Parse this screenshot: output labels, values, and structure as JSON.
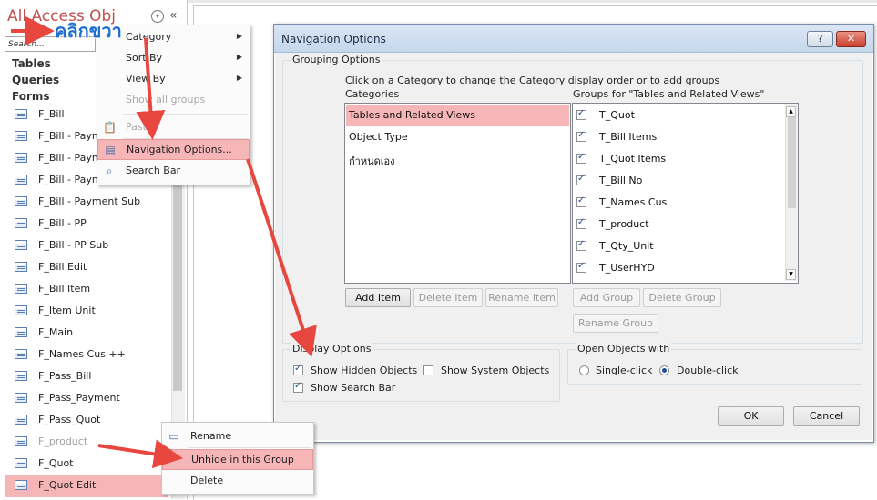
{
  "nav_pane": {
    "title": "All Access Obj",
    "collapse_glyph": "«",
    "dropdown_glyph": "▾",
    "search_placeholder": "Search...",
    "groups": [
      "Tables",
      "Queries",
      "Forms"
    ],
    "forms": [
      {
        "label": "F_Bill",
        "state": "normal"
      },
      {
        "label": "F_Bill - Paym",
        "state": "normal"
      },
      {
        "label": "F_Bill - Paym",
        "state": "normal"
      },
      {
        "label": "F_Bill - Paym",
        "state": "normal"
      },
      {
        "label": "F_Bill - Payment Sub",
        "state": "normal"
      },
      {
        "label": "F_Bill - PP",
        "state": "normal"
      },
      {
        "label": "F_Bill - PP Sub",
        "state": "normal"
      },
      {
        "label": "F_Bill Edit",
        "state": "normal"
      },
      {
        "label": "F_Bill Item",
        "state": "normal"
      },
      {
        "label": "F_Item Unit",
        "state": "normal"
      },
      {
        "label": "F_Main",
        "state": "normal"
      },
      {
        "label": "F_Names Cus ++",
        "state": "normal"
      },
      {
        "label": "F_Pass_Bill",
        "state": "normal"
      },
      {
        "label": "F_Pass_Payment",
        "state": "normal"
      },
      {
        "label": "F_Pass_Quot",
        "state": "normal"
      },
      {
        "label": "F_product",
        "state": "hidden"
      },
      {
        "label": "F_Quot",
        "state": "normal"
      },
      {
        "label": "F_Quot Edit",
        "state": "selected"
      }
    ]
  },
  "annotation": {
    "thai_text": "คลิกขวา",
    "arrow_color": "#e8473f"
  },
  "context_menu_nav": {
    "items": [
      {
        "label": "Category",
        "submenu": true,
        "disabled": false
      },
      {
        "label": "Sort By",
        "submenu": true,
        "disabled": false
      },
      {
        "label": "View By",
        "submenu": true,
        "disabled": false
      },
      {
        "label": "Show all groups",
        "submenu": false,
        "disabled": true
      },
      {
        "label": "Paste",
        "submenu": false,
        "disabled": true,
        "icon": "paste-icon"
      },
      {
        "label": "Navigation Options...",
        "submenu": false,
        "disabled": false,
        "highlighted": true,
        "icon": "navigation-options-icon"
      },
      {
        "label": "Search Bar",
        "submenu": false,
        "disabled": false,
        "icon": "search-icon"
      }
    ]
  },
  "context_menu_item": {
    "items": [
      {
        "label": "Rename",
        "icon": "rename-icon"
      },
      {
        "label": "Unhide in this Group",
        "highlighted": true
      },
      {
        "label": "Delete"
      }
    ]
  },
  "dialog": {
    "title": "Navigation Options",
    "help_label": "?",
    "close_label": "✕",
    "grouping_title": "Grouping Options",
    "instruction": "Click on a Category to change the Category display order or to add groups",
    "categories_header": "Categories",
    "groups_header": "Groups for \"Tables and Related Views\"",
    "categories": [
      {
        "label": "Tables and Related Views",
        "selected": true
      },
      {
        "label": "Object Type",
        "selected": false
      },
      {
        "label": "กำหนดเอง",
        "selected": false
      }
    ],
    "groups": [
      {
        "label": "T_Quot",
        "checked": true
      },
      {
        "label": "T_Bill Items",
        "checked": true
      },
      {
        "label": "T_Quot Items",
        "checked": true
      },
      {
        "label": "T_Bill No",
        "checked": true
      },
      {
        "label": "T_Names Cus",
        "checked": true
      },
      {
        "label": "T_product",
        "checked": true
      },
      {
        "label": "T_Qty_Unit",
        "checked": true
      },
      {
        "label": "T_UserHYD",
        "checked": true
      }
    ],
    "buttons": {
      "add_item": "Add Item",
      "delete_item": "Delete Item",
      "rename_item": "Rename Item",
      "add_group": "Add Group",
      "delete_group": "Delete Group",
      "rename_group": "Rename Group",
      "ok": "OK",
      "cancel": "Cancel"
    },
    "display_title": "Display Options",
    "show_hidden": {
      "label": "Show Hidden Objects",
      "checked": true
    },
    "show_system": {
      "label": "Show System Objects",
      "checked": false
    },
    "show_search": {
      "label": "Show Search Bar",
      "checked": true
    },
    "open_title": "Open Objects with",
    "single_click": {
      "label": "Single-click",
      "selected": false
    },
    "double_click": {
      "label": "Double-click",
      "selected": true
    }
  }
}
